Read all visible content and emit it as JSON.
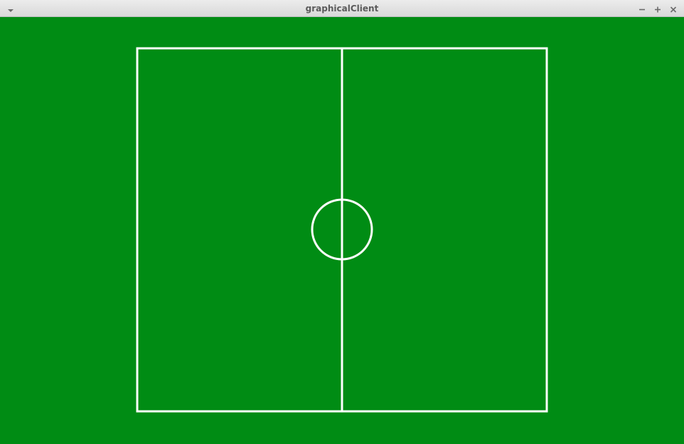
{
  "window": {
    "title": "graphicalClient",
    "menu_icon": "chevron-down-icon",
    "controls": {
      "minimize_icon": "minimize-icon",
      "maximize_icon": "maximize-icon",
      "close_icon": "close-icon"
    }
  },
  "field": {
    "background_color": "#008c14",
    "line_color": "#ffffff"
  }
}
